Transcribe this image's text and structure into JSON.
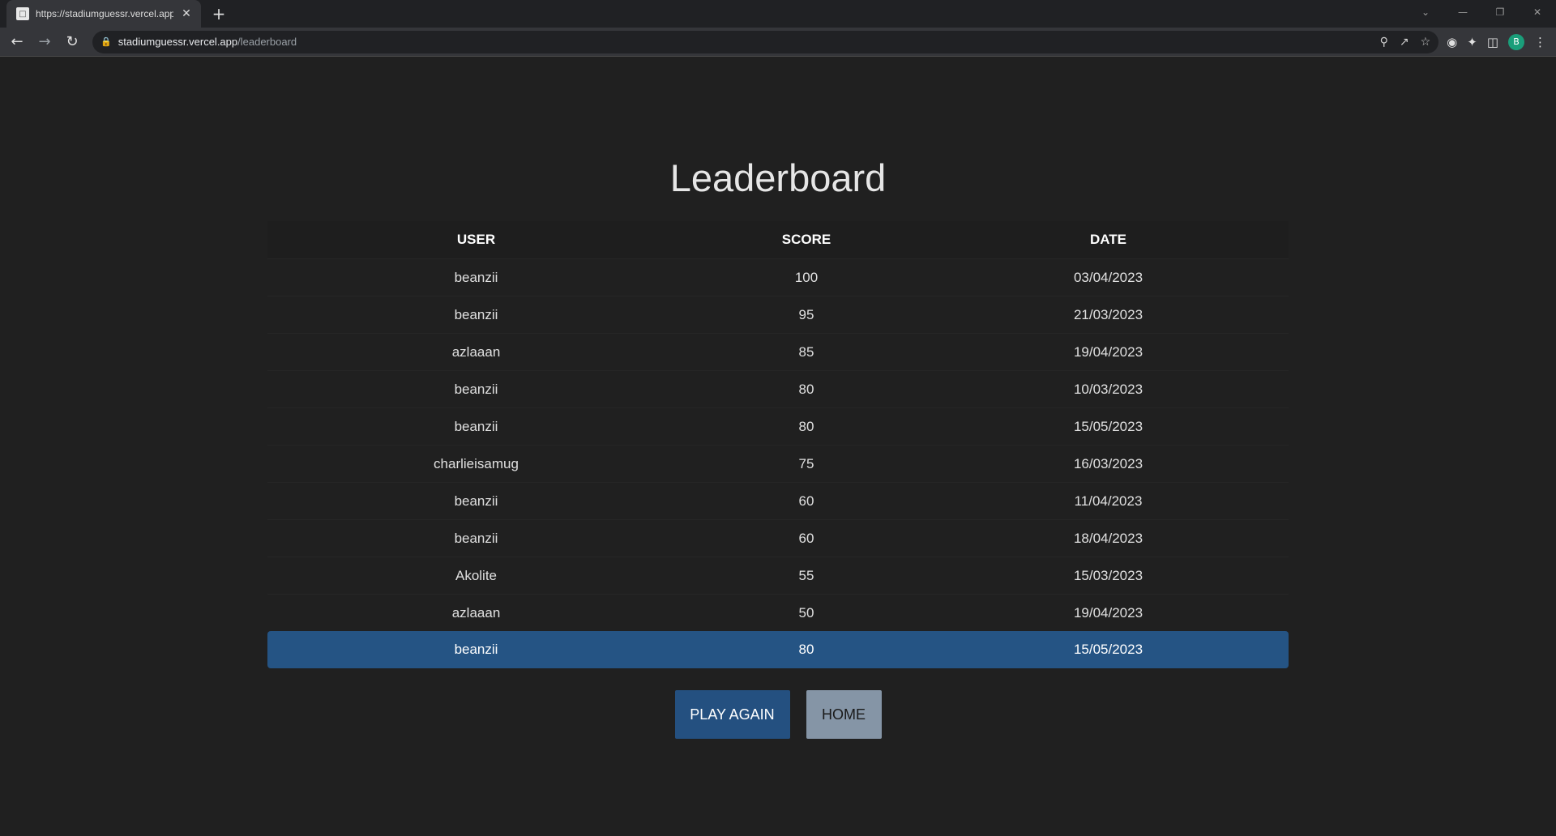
{
  "browser": {
    "tab_title": "https://stadiumguessr.vercel.app/",
    "url_host": "stadiumguessr.vercel.app",
    "url_path": "/leaderboard",
    "profile_initial": "B"
  },
  "page": {
    "title": "Leaderboard",
    "columns": [
      "USER",
      "SCORE",
      "DATE"
    ],
    "rows": [
      {
        "user": "beanzii",
        "score": "100",
        "date": "03/04/2023"
      },
      {
        "user": "beanzii",
        "score": "95",
        "date": "21/03/2023"
      },
      {
        "user": "azlaaan",
        "score": "85",
        "date": "19/04/2023"
      },
      {
        "user": "beanzii",
        "score": "80",
        "date": "10/03/2023"
      },
      {
        "user": "beanzii",
        "score": "80",
        "date": "15/05/2023"
      },
      {
        "user": "charlieisamug",
        "score": "75",
        "date": "16/03/2023"
      },
      {
        "user": "beanzii",
        "score": "60",
        "date": "11/04/2023"
      },
      {
        "user": "beanzii",
        "score": "60",
        "date": "18/04/2023"
      },
      {
        "user": "Akolite",
        "score": "55",
        "date": "15/03/2023"
      },
      {
        "user": "azlaaan",
        "score": "50",
        "date": "19/04/2023"
      }
    ],
    "current_user_row": {
      "user": "beanzii",
      "score": "80",
      "date": "15/05/2023"
    },
    "buttons": {
      "play_again": "PLAY AGAIN",
      "home": "HOME"
    }
  },
  "colors": {
    "background": "#202020",
    "highlight_row": "#255484",
    "primary_button": "#245080",
    "secondary_button": "#8595a6"
  }
}
